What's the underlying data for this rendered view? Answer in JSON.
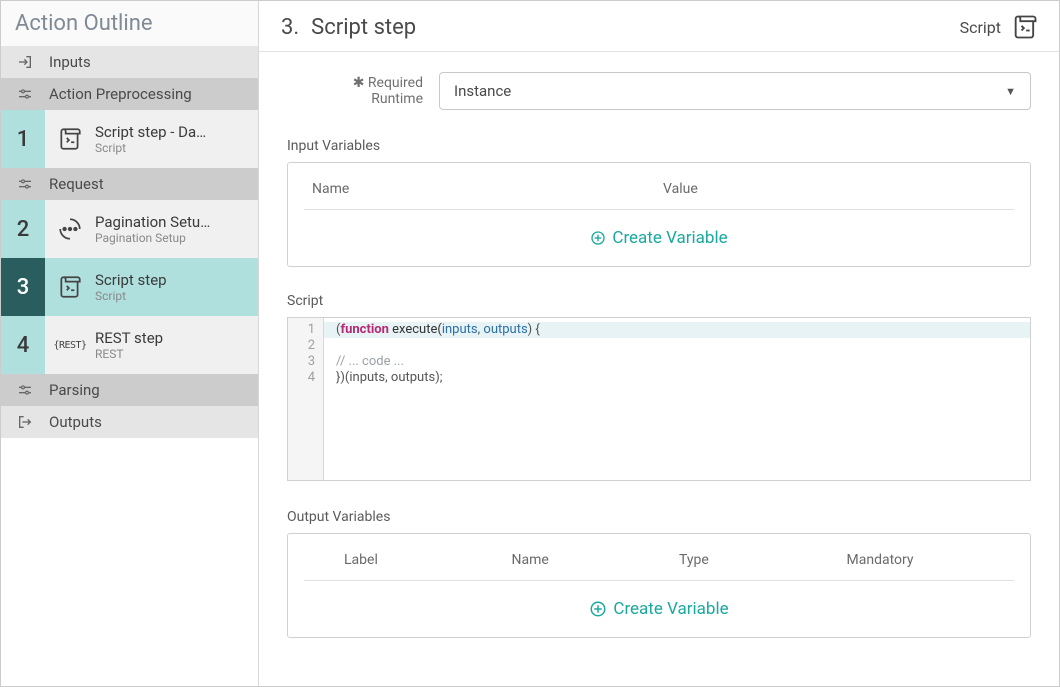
{
  "sidebar": {
    "title": "Action Outline",
    "inputs_label": "Inputs",
    "preproc_label": "Action Preprocessing",
    "request_label": "Request",
    "parsing_label": "Parsing",
    "outputs_label": "Outputs",
    "steps": [
      {
        "num": "1",
        "title": "Script step - Da…",
        "sub": "Script"
      },
      {
        "num": "2",
        "title": "Pagination Setu…",
        "sub": "Pagination Setup"
      },
      {
        "num": "3",
        "title": "Script step",
        "sub": "Script"
      },
      {
        "num": "4",
        "title": "REST step",
        "sub": "REST"
      }
    ]
  },
  "header": {
    "num": "3.",
    "title": "Script step",
    "type": "Script"
  },
  "form": {
    "required_label": "✱ Required",
    "runtime_label": "Runtime",
    "runtime_value": "Instance"
  },
  "input_vars": {
    "section_label": "Input Variables",
    "col_name": "Name",
    "col_value": "Value",
    "create_label": "Create Variable"
  },
  "script": {
    "section_label": "Script",
    "lines": {
      "l1": "1",
      "l2": "2",
      "l3": "3",
      "l4": "4"
    },
    "code": {
      "open_paren": "(",
      "kw_function": "function",
      "fn_name": " execute(",
      "arg1": "inputs",
      "comma": ", ",
      "arg2": "outputs",
      "close_args": ") {",
      "comment": "// ... code ...",
      "close": "})(inputs, outputs);"
    }
  },
  "output_vars": {
    "section_label": "Output Variables",
    "col_label": "Label",
    "col_name": "Name",
    "col_type": "Type",
    "col_mandatory": "Mandatory",
    "create_label": "Create Variable"
  }
}
